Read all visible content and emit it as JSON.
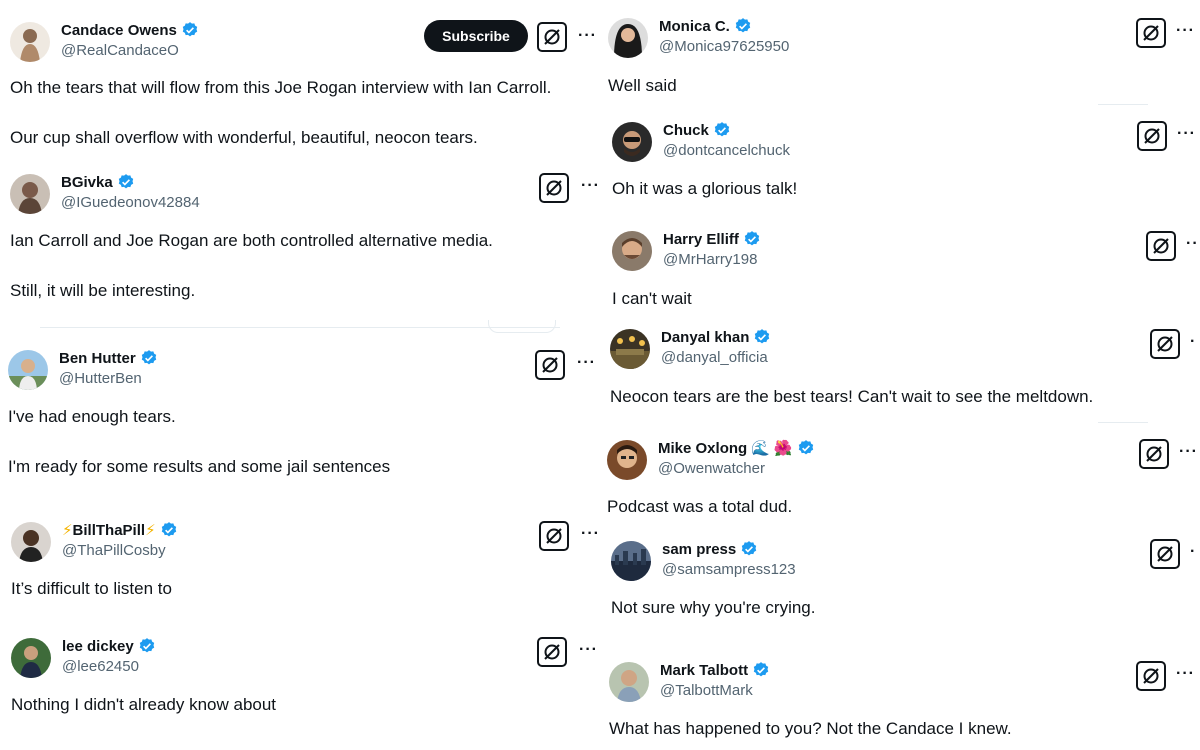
{
  "subscribe_label": "Subscribe",
  "more_label": "···",
  "colors": {
    "verified": "#1d9bf0",
    "text": "#0f1419",
    "handle": "#536471"
  },
  "icons": {
    "verified": "verified-badge-icon",
    "grok": "grok-icon"
  },
  "left_tweets": [
    {
      "name": "Candace Owens",
      "handle": "@RealCandaceO",
      "lines": [
        "Oh the tears that will flow from this Joe Rogan interview with Ian Carroll.",
        "Our cup shall overflow with wonderful, beautiful, neocon tears."
      ]
    },
    {
      "name": "BGivka",
      "handle": "@IGuedeonov42884",
      "lines": [
        "Ian Carroll and Joe Rogan are both controlled alternative media.",
        "Still, it will be interesting."
      ]
    },
    {
      "name": "Ben Hutter",
      "handle": "@HutterBen",
      "lines": [
        "I've had enough tears.",
        "I'm ready for some results and some jail sentences"
      ]
    },
    {
      "name": "BillThaPill",
      "name_prefix": "⚡",
      "name_suffix": "⚡",
      "handle": "@ThaPillCosby",
      "lines": [
        "It’s difficult to listen to"
      ]
    },
    {
      "name": "lee dickey",
      "handle": "@lee62450",
      "lines": [
        "Nothing I didn't already know about"
      ]
    }
  ],
  "right_tweets": [
    {
      "name": "Monica C.",
      "handle": "@Monica97625950",
      "lines": [
        "Well said"
      ]
    },
    {
      "name": "Chuck",
      "handle": "@dontcancelchuck",
      "lines": [
        "Oh it was a glorious talk!"
      ]
    },
    {
      "name": "Harry Elliff",
      "handle": "@MrHarry198",
      "lines": [
        "I can't wait"
      ]
    },
    {
      "name": "Danyal khan",
      "handle": "@danyal_officia",
      "lines": [
        "Neocon tears are the best tears! Can't wait to see the meltdown."
      ]
    },
    {
      "name": "Mike Oxlong",
      "name_emoji_1": "🌊",
      "name_emoji_2": "🌺",
      "handle": "@Owenwatcher",
      "lines": [
        "Podcast was a total dud."
      ]
    },
    {
      "name": "sam press",
      "handle": "@samsampress123",
      "lines": [
        "Not sure why you're crying."
      ]
    },
    {
      "name": "Mark Talbott",
      "handle": "@TalbottMark",
      "lines": [
        "What has happened to you? Not the Candace I knew."
      ]
    }
  ]
}
